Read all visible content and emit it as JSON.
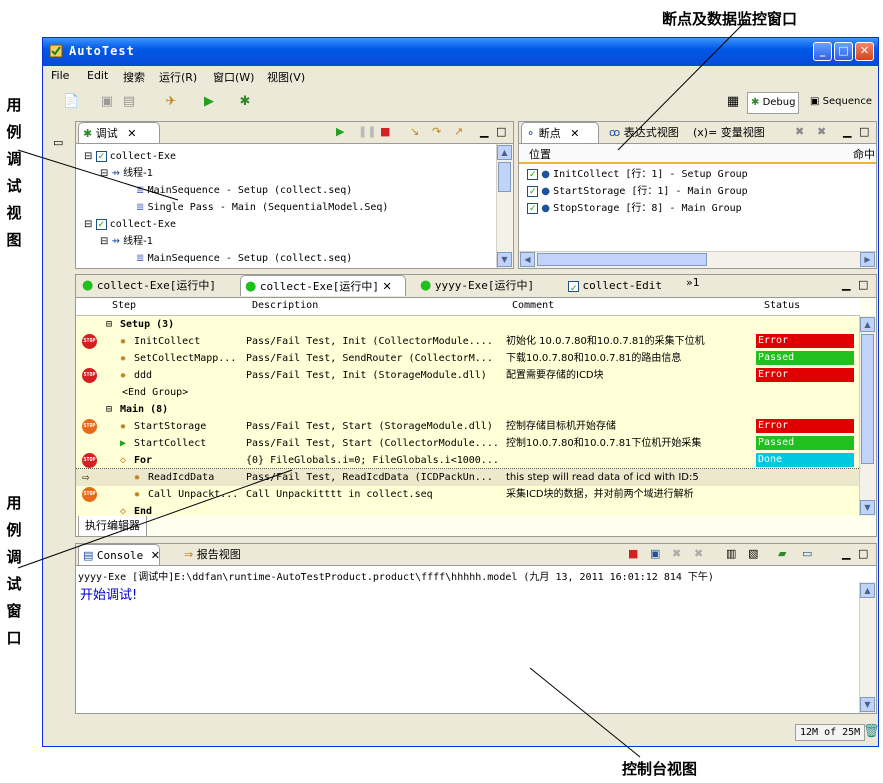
{
  "annotations": {
    "breakpoint_window": "断点及数据监控窗口",
    "usecase_view": "用例调试视图",
    "usecase_window": "用例调试窗口",
    "console_view": "控制台视图"
  },
  "window": {
    "title": "AutoTest",
    "menu": [
      "File",
      "Edit",
      "搜索",
      "运行(R)",
      "窗口(W)",
      "视图(V)"
    ],
    "perspectives": [
      "Debug",
      "Sequence"
    ]
  },
  "debug_panel": {
    "tab_label": "调试",
    "tree": [
      {
        "text": "collect-Exe",
        "level": 0
      },
      {
        "text": "线程-1",
        "level": 1
      },
      {
        "text": "MainSequence - Setup (collect.seq)",
        "level": 2
      },
      {
        "text": "Single Pass - Main (SequentialModel.Seq)",
        "level": 2
      },
      {
        "text": "collect-Exe",
        "level": 0
      },
      {
        "text": "线程-1",
        "level": 1
      },
      {
        "text": "MainSequence - Setup (collect.seq)",
        "level": 2
      }
    ]
  },
  "breakpoint_panel": {
    "tabs": [
      "断点",
      "表达式视图",
      "(x)= 变量视图"
    ],
    "columns": [
      "位置",
      "命中"
    ],
    "items": [
      "InitCollect [行：1] - Setup Group",
      "StartStorage [行：1] - Main Group",
      "StopStorage [行：8] - Main Group"
    ]
  },
  "editor": {
    "tabs": [
      "collect-Exe[运行中]",
      "collect-Exe[运行中]",
      "yyyy-Exe[运行中]",
      "collect-Edit"
    ],
    "overflow": "»1",
    "columns": [
      "Step",
      "Description",
      "Comment",
      "Status"
    ],
    "rows": [
      {
        "step": "Setup (3)",
        "group": true,
        "stop": "",
        "desc": "",
        "comment": "",
        "status": "",
        "status_color": ""
      },
      {
        "step": "InitCollect",
        "stop": "red",
        "desc": "Pass/Fail Test,  Init (CollectorModule....",
        "comment": "初始化 10.0.7.80和10.0.7.81的采集下位机",
        "status": "Error",
        "status_color": "#e00000"
      },
      {
        "step": "SetCollectMapp...",
        "stop": "",
        "desc": "Pass/Fail Test,  SendRouter (CollectorM...",
        "comment": "下载10.0.7.80和10.0.7.81的路由信息",
        "status": "Passed",
        "status_color": "#21c021"
      },
      {
        "step": "ddd",
        "stop": "red",
        "desc": "Pass/Fail Test,  Init (StorageModule.dll)",
        "comment": "配置需要存储的ICD块",
        "status": "Error",
        "status_color": "#e00000"
      },
      {
        "step": "<End Group>",
        "stop": "",
        "desc": "",
        "comment": "",
        "status": "",
        "status_color": ""
      },
      {
        "step": "Main (8)",
        "group": true,
        "stop": "",
        "desc": "",
        "comment": "",
        "status": "",
        "status_color": ""
      },
      {
        "step": "StartStorage",
        "stop": "orange",
        "desc": "Pass/Fail Test,  Start (StorageModule.dll)",
        "comment": "控制存储目标机开始存储",
        "status": "Error",
        "status_color": "#e00000"
      },
      {
        "step": "StartCollect",
        "stop": "",
        "desc": "Pass/Fail Test,  Start (CollectorModule....",
        "comment": "控制10.0.7.80和10.0.7.81下位机开始采集",
        "status": "Passed",
        "status_color": "#21c021"
      },
      {
        "step": "For",
        "stop": "red",
        "desc": "{0} FileGlobals.i=0; FileGlobals.i<1000...",
        "comment": "",
        "status": "Done",
        "status_color": "#00c8e0"
      },
      {
        "step": "ReadIcdData",
        "stop": "",
        "desc": "Pass/Fail Test,  ReadIcdData (ICDPackUn...",
        "comment": "this step will read data of icd with ID:5",
        "status": "",
        "status_color": ""
      },
      {
        "step": "Call Unpackt...",
        "stop": "orange",
        "desc": "Call Unpackitttt in collect.seq",
        "comment": "采集ICD块的数据，并对前两个域进行解析",
        "status": "",
        "status_color": ""
      },
      {
        "step": "End",
        "stop": "",
        "desc": "",
        "comment": "",
        "status": "",
        "status_color": ""
      }
    ],
    "bottom_tab": "执行编辑器"
  },
  "console": {
    "tabs": [
      "Console",
      "报告视图"
    ],
    "path": "yyyy-Exe [调试中]E:\\ddfan\\runtime-AutoTestProduct.product\\ffff\\hhhhh.model (九月 13, 2011 16:01:12 814 下午)",
    "output": "开始调试!"
  },
  "statusbar": {
    "memory": "12M of 25M"
  }
}
